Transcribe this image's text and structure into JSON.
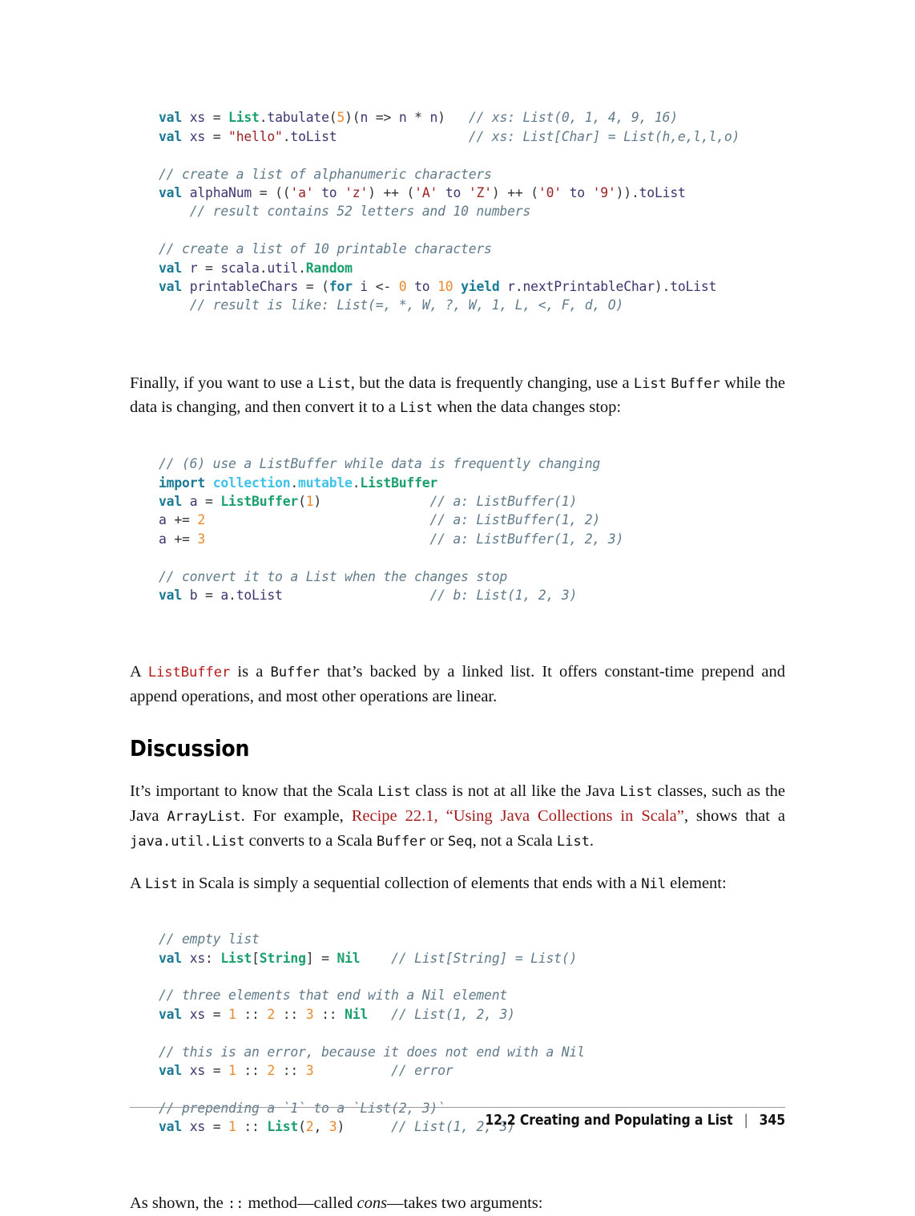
{
  "page": {
    "footer_title": "12.2 Creating and Populating a List",
    "footer_separator": "|",
    "page_number": "345"
  },
  "colors": {
    "keyword": "#1a7a96",
    "type": "#1aa06d",
    "package": "#3fc3e8",
    "number": "#e8892b",
    "string": "#9b2323",
    "comment": "#5f7a8a",
    "identifier": "#3b3570",
    "link": "#a81c1c",
    "inline_code_red": "#b31a1a",
    "text": "#111111",
    "background": "#ffffff"
  },
  "code_block_1": {
    "lines": [
      "val xs = List.tabulate(5)(n => n * n)   // xs: List(0, 1, 4, 9, 16)",
      "val xs = \"hello\".toList                 // xs: List[Char] = List(h,e,l,l,o)",
      "",
      "// create a list of alphanumeric characters",
      "val alphaNum = (('a' to 'z') ++ ('A' to 'Z') ++ ('0' to '9')).toList",
      "    // result contains 52 letters and 10 numbers",
      "",
      "// create a list of 10 printable characters",
      "val r = scala.util.Random",
      "val printableChars = (for i <- 0 to 10 yield r.nextPrintableChar).toList",
      "    // result is like: List(=, *, W, ?, W, 1, L, <, F, d, O)"
    ]
  },
  "paragraph_1": {
    "segments": [
      {
        "text": "Finally, if you want to use a ",
        "style": "text"
      },
      {
        "text": "List",
        "style": "mono"
      },
      {
        "text": ", but the data is frequently changing, use a ",
        "style": "text"
      },
      {
        "text": "List",
        "style": "mono"
      },
      {
        "text": " ",
        "style": "text"
      },
      {
        "text": "Buffer",
        "style": "mono"
      },
      {
        "text": " while the data is changing, and then convert it to a ",
        "style": "text"
      },
      {
        "text": "List",
        "style": "mono"
      },
      {
        "text": " when the data changes stop:",
        "style": "text"
      }
    ]
  },
  "code_block_2": {
    "lines": [
      "// (6) use a ListBuffer while data is frequently changing",
      "import collection.mutable.ListBuffer",
      "val a = ListBuffer(1)              // a: ListBuffer(1)",
      "a += 2                             // a: ListBuffer(1, 2)",
      "a += 3                             // a: ListBuffer(1, 2, 3)",
      "",
      "// convert it to a List when the changes stop",
      "val b = a.toList                   // b: List(1, 2, 3)"
    ]
  },
  "paragraph_2": {
    "segments": [
      {
        "text": "A ",
        "style": "text"
      },
      {
        "text": "ListBuffer",
        "style": "mono-red"
      },
      {
        "text": " is a ",
        "style": "text"
      },
      {
        "text": "Buffer",
        "style": "mono"
      },
      {
        "text": " that’s backed by a linked list. It offers constant-time prepend and append operations, and most other operations are linear.",
        "style": "text"
      }
    ]
  },
  "heading_discussion": "Discussion",
  "paragraph_3": {
    "segments": [
      {
        "text": "It’s important to know that the Scala ",
        "style": "text"
      },
      {
        "text": "List",
        "style": "mono"
      },
      {
        "text": " class is not at all like the Java ",
        "style": "text"
      },
      {
        "text": "List",
        "style": "mono"
      },
      {
        "text": " classes, such as the Java ",
        "style": "text"
      },
      {
        "text": "ArrayList",
        "style": "mono"
      },
      {
        "text": ". For example, ",
        "style": "text"
      },
      {
        "text": "Recipe 22.1, “Using Java Collections in Scala”",
        "style": "link"
      },
      {
        "text": ", shows that a ",
        "style": "text"
      },
      {
        "text": "java.util.List",
        "style": "mono"
      },
      {
        "text": " converts to a Scala ",
        "style": "text"
      },
      {
        "text": "Buffer",
        "style": "mono"
      },
      {
        "text": " or ",
        "style": "text"
      },
      {
        "text": "Seq",
        "style": "mono"
      },
      {
        "text": ", not a Scala ",
        "style": "text"
      },
      {
        "text": "List",
        "style": "mono"
      },
      {
        "text": ".",
        "style": "text"
      }
    ]
  },
  "paragraph_4": {
    "segments": [
      {
        "text": "A ",
        "style": "text"
      },
      {
        "text": "List",
        "style": "mono"
      },
      {
        "text": " in Scala is simply a sequential collection of elements that ends with a ",
        "style": "text"
      },
      {
        "text": "Nil",
        "style": "mono"
      },
      {
        "text": " element:",
        "style": "text"
      }
    ]
  },
  "code_block_3": {
    "lines": [
      "// empty list",
      "val xs: List[String] = Nil    // List[String] = List()",
      "",
      "// three elements that end with a Nil element",
      "val xs = 1 :: 2 :: 3 :: Nil   // List(1, 2, 3)",
      "",
      "// this is an error, because it does not end with a Nil",
      "val xs = 1 :: 2 :: 3          // error",
      "",
      "// prepending a `1` to a `List(2, 3)`",
      "val xs = 1 :: List(2, 3)      // List(1, 2, 3)"
    ]
  },
  "paragraph_5": {
    "segments": [
      {
        "text": "As shown, the ",
        "style": "text"
      },
      {
        "text": "::",
        "style": "mono"
      },
      {
        "text": " method—called ",
        "style": "text"
      },
      {
        "text": "cons",
        "style": "italic"
      },
      {
        "text": "—takes two arguments:",
        "style": "text"
      }
    ]
  }
}
